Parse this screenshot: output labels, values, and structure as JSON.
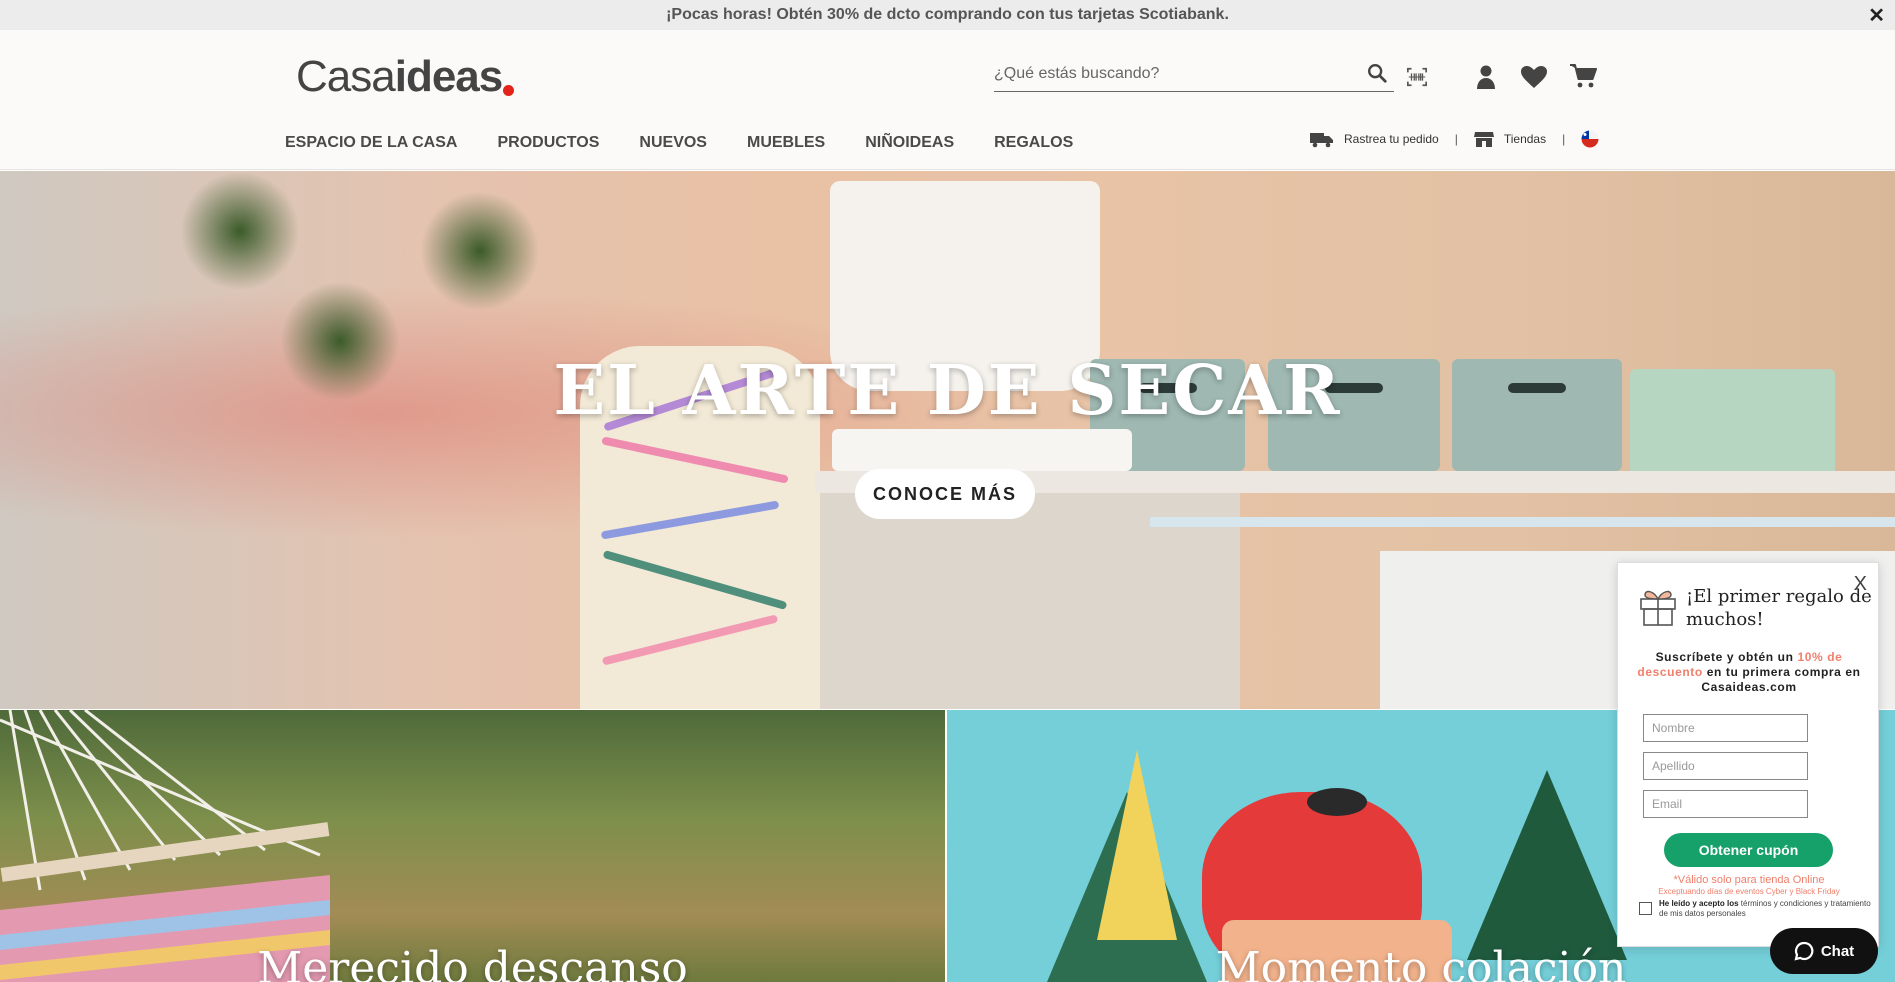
{
  "promo": {
    "text": "¡Pocas horas! Obtén 30% de dcto comprando con tus tarjetas Scotiabank.",
    "close": "✕"
  },
  "header": {
    "logo_part1": "Casa",
    "logo_part2": "ideas",
    "search_placeholder": "¿Qué estás buscando?",
    "icons": [
      "search-icon",
      "barcode-scan-icon",
      "user-icon",
      "heart-icon",
      "cart-icon"
    ]
  },
  "nav": {
    "items": [
      "ESPACIO DE LA CASA",
      "PRODUCTOS",
      "NUEVOS",
      "MUEBLES",
      "NIÑOIDEAS",
      "REGALOS"
    ]
  },
  "utility": {
    "track_order": "Rastrea tu pedido",
    "stores": "Tiendas",
    "separator": "|",
    "country_flag": "chile-flag-icon"
  },
  "hero": {
    "title": "EL ARTE DE SECAR",
    "button": "CONOCE MÁS"
  },
  "tiles": [
    {
      "title": "Merecido descanso"
    },
    {
      "title": "Momento colación"
    }
  ],
  "popup": {
    "close": "X",
    "title": "¡El primer regalo de muchos!",
    "desc_prefix": "Suscríbete y obtén un ",
    "desc_highlight": "10% de descuento",
    "desc_suffix": " en tu primera compra en Casaideas.com",
    "field_name": "Nombre",
    "field_lastname": "Apellido",
    "field_email": "Email",
    "button": "Obtener cupón",
    "note_main": "*Válido solo para tienda Online",
    "note_sub": "Exceptuando días de eventos Cyber y Black Friday",
    "terms_prefix": "He leído y acepto los",
    "terms_suffix": " términos y condiciones y tratamiento de mis datos personales"
  },
  "chat": {
    "label": "Chat"
  },
  "colors": {
    "accent_green": "#16a06a",
    "highlight_coral": "#f07e6b",
    "logo_red": "#e2231a"
  }
}
